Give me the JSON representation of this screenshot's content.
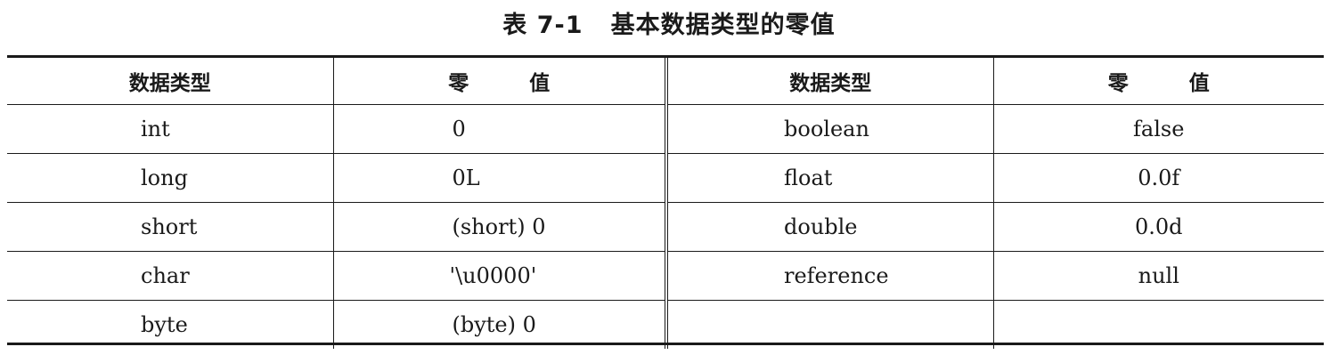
{
  "caption": "表 7-1   基本数据类型的零值",
  "table": {
    "headers": {
      "left_type": "数据类型",
      "left_zero": "零 值",
      "right_type": "数据类型",
      "right_zero": "零 值"
    },
    "rows": [
      {
        "left_type": "int",
        "left_zero": "0",
        "right_type": "boolean",
        "right_zero": "false"
      },
      {
        "left_type": "long",
        "left_zero": "0L",
        "right_type": "float",
        "right_zero": "0.0f"
      },
      {
        "left_type": "short",
        "left_zero": "(short) 0",
        "right_type": "double",
        "right_zero": "0.0d"
      },
      {
        "left_type": "char",
        "left_zero": "'\\u0000'",
        "right_type": "reference",
        "right_zero": "null"
      },
      {
        "left_type": "byte",
        "left_zero": "(byte) 0",
        "right_type": "",
        "right_zero": ""
      }
    ]
  }
}
